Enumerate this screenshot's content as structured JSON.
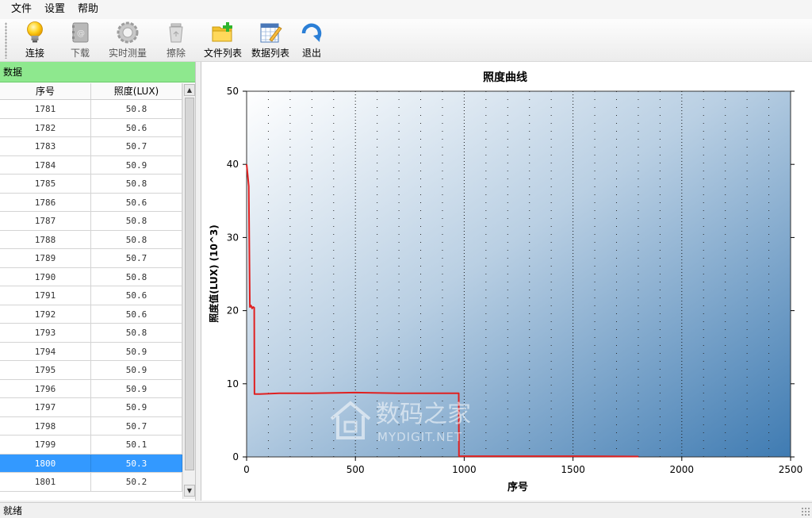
{
  "menu": [
    "文件",
    "设置",
    "帮助"
  ],
  "toolbar": [
    {
      "label": "连接",
      "icon": "lightbulb-icon",
      "enabled": true
    },
    {
      "label": "下载",
      "icon": "address-book-icon",
      "enabled": false
    },
    {
      "label": "实时测量",
      "icon": "gear-icon",
      "enabled": false
    },
    {
      "label": "擦除",
      "icon": "trash-icon",
      "enabled": false
    },
    {
      "label": "文件列表",
      "icon": "folder-add-icon",
      "enabled": true
    },
    {
      "label": "数据列表",
      "icon": "calendar-pencil-icon",
      "enabled": true
    },
    {
      "label": "退出",
      "icon": "exit-arrow-icon",
      "enabled": true
    }
  ],
  "data_panel": {
    "title": "数据",
    "columns": [
      "序号",
      "照度(LUX)"
    ],
    "rows": [
      [
        "1781",
        "50.8"
      ],
      [
        "1782",
        "50.6"
      ],
      [
        "1783",
        "50.7"
      ],
      [
        "1784",
        "50.9"
      ],
      [
        "1785",
        "50.8"
      ],
      [
        "1786",
        "50.6"
      ],
      [
        "1787",
        "50.8"
      ],
      [
        "1788",
        "50.8"
      ],
      [
        "1789",
        "50.7"
      ],
      [
        "1790",
        "50.8"
      ],
      [
        "1791",
        "50.6"
      ],
      [
        "1792",
        "50.6"
      ],
      [
        "1793",
        "50.8"
      ],
      [
        "1794",
        "50.9"
      ],
      [
        "1795",
        "50.9"
      ],
      [
        "1796",
        "50.9"
      ],
      [
        "1797",
        "50.9"
      ],
      [
        "1798",
        "50.7"
      ],
      [
        "1799",
        "50.1"
      ],
      [
        "1800",
        "50.3"
      ],
      [
        "1801",
        "50.2"
      ]
    ],
    "selected_row": "1800"
  },
  "chart_data": {
    "type": "line",
    "title": "照度曲线",
    "xlabel": "序号",
    "ylabel": "照度值(LUX) (10^3)",
    "xlim": [
      0,
      2500
    ],
    "ylim": [
      0,
      50
    ],
    "xticks": [
      0,
      500,
      1000,
      1500,
      2000,
      2500
    ],
    "yticks": [
      0,
      10,
      20,
      30,
      40,
      50
    ],
    "grid": true,
    "background": "gradient white to steel blue",
    "series": [
      {
        "color": "#e02020",
        "x": [
          0,
          5,
          10,
          15,
          20,
          25,
          30,
          35,
          36,
          40,
          60,
          150,
          300,
          500,
          700,
          850,
          975,
          976,
          1000,
          1200,
          1500,
          1801
        ],
        "y": [
          40,
          38.5,
          37,
          20.5,
          20.7,
          20.3,
          20.5,
          20.4,
          8.6,
          8.6,
          8.6,
          8.7,
          8.7,
          8.8,
          8.7,
          8.7,
          8.7,
          0.1,
          0.1,
          0.1,
          0.1,
          0.05
        ]
      }
    ]
  },
  "watermark": {
    "cn": "数码之家",
    "en": "MYDIGIT.NET"
  },
  "status": "就绪"
}
